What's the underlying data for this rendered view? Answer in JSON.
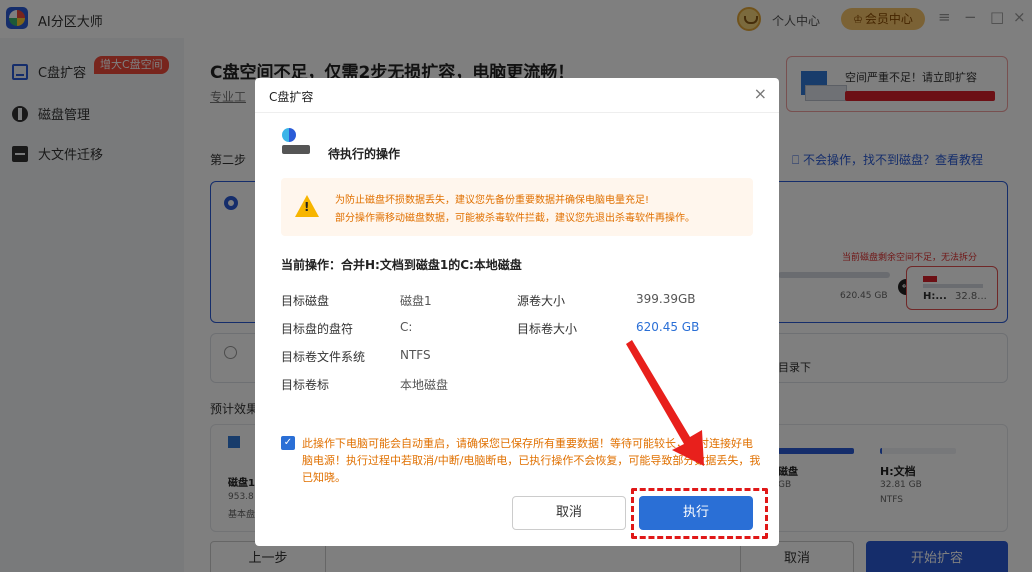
{
  "app": {
    "title": "AI分区大师",
    "personal_center": "个人中心",
    "member_center": "会员中心",
    "controls": {
      "menu": "≡",
      "minimize": "−",
      "maximize": "□",
      "close": "×"
    }
  },
  "sidebar": {
    "items": [
      {
        "label": "C盘扩容",
        "icon": "c-drive-icon",
        "badge": "增大C盘空间"
      },
      {
        "label": "磁盘管理",
        "icon": "disk-icon"
      },
      {
        "label": "大文件迁移",
        "icon": "file-move-icon"
      }
    ]
  },
  "main": {
    "heading": "C盘空间不足，仅需2步无损扩容，电脑更流畅！",
    "sub": "专业工",
    "warn_card": {
      "text": "空间严重不足！请立即扩容"
    },
    "step2": "第二步",
    "help_link": "不会操作，找不到磁盘？查看教程",
    "red_note": "当前磁盘剩余空间不足，无法拆分",
    "size_620": "620.45 GB",
    "h_card": {
      "name": "H:...",
      "size": "32.8..."
    },
    "dir_text": "目录下",
    "preview_label": "预计效果",
    "preview": {
      "disk1_name": "磁盘1",
      "disk1_size": "953.8",
      "disk1_type": "基本盘",
      "disk2_name": "磁盘",
      "disk2_size": "GB",
      "h_name": "H:文档",
      "h_size": "32.81 GB",
      "h_fs": "NTFS"
    },
    "buttons": {
      "prev": "上一步",
      "cancel": "取消",
      "start": "开始扩容"
    }
  },
  "dialog": {
    "title": "C盘扩容",
    "close": "×",
    "pending_title": "待执行的操作",
    "warning_line1": "为防止磁盘坏损数据丢失，建议您先备份重要数据并确保电脑电量充足!",
    "warning_line2": "部分操作需移动磁盘数据，可能被杀毒软件拦截，建议您先退出杀毒软件再操作。",
    "current_op": "当前操作：合并H:文档到磁盘1的C:本地磁盘",
    "details": {
      "target_disk_label": "目标磁盘",
      "target_disk_value": "磁盘1",
      "target_letter_label": "目标盘的盘符",
      "target_letter_value": "C:",
      "target_fs_label": "目标卷文件系统",
      "target_fs_value": "NTFS",
      "target_label_label": "目标卷标",
      "target_label_value": "本地磁盘",
      "source_size_label": "源卷大小",
      "source_size_value": "399.39GB",
      "target_size_label": "目标卷大小",
      "target_size_value": "620.45 GB"
    },
    "confirm_checked": true,
    "confirm_text": "此操作下电脑可能会自动重启，请确保您已保存所有重要数据！等待可能较长，同时连接好电脑电源！执行过程中若取消/中断/电脑断电，已执行操作不会恢复，可能导致部分数据丢失，我已知晓。",
    "cancel_label": "取消",
    "execute_label": "执行"
  }
}
